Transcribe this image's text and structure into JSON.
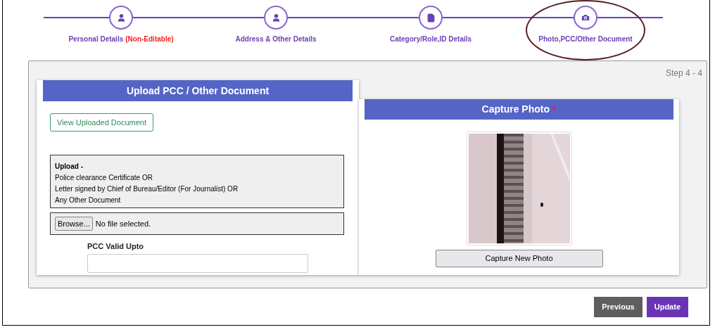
{
  "steps": [
    {
      "label": "Personal Details",
      "note": "(Non-Editable)",
      "kind": "person",
      "circled": false
    },
    {
      "label": "Address & Other Details",
      "kind": "person",
      "circled": false
    },
    {
      "label": "Category/Role,ID Details",
      "kind": "document",
      "circled": false
    },
    {
      "label": "Photo,PCC/Other Document",
      "circled": true
    }
  ],
  "step_counter": "Step 4 - 4",
  "upload_card": {
    "title": "Upload PCC / Other Document",
    "view_button": "View Uploaded Document",
    "info_heading": "Upload -",
    "info_lines": [
      "Police clearance Certificate OR",
      "Letter signed by Chief of Bureau/Editor (For Journalist) OR",
      "Any Other Document"
    ],
    "browse_button": "Browse...",
    "file_status": "No file selected.",
    "pcc_label": "PCC Valid Upto"
  },
  "photo_card": {
    "title": "Capture Photo",
    "required_mark": "*",
    "capture_button": "Capture New Photo"
  },
  "buttons": [
    {
      "label": "Previous",
      "kind": "secondary"
    },
    {
      "label": "Update",
      "kind": "primary"
    }
  ]
}
